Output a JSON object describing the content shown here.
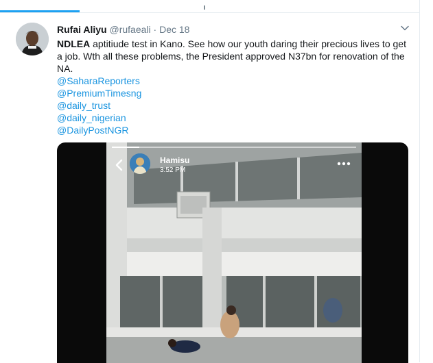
{
  "tweet": {
    "author_name": "Rufai Aliyu",
    "handle": "@rufaeali",
    "separator": "·",
    "date": "Dec 18",
    "text_bold": "NDLEA",
    "text_rest": " aptitiude test in Kano. See how our youth daring their precious lives to get a job. Wth all these problems, the President approved N37bn for renovation of the NA.",
    "mentions": [
      "@SaharaReporters",
      "@PremiumTimesng",
      "@daily_trust",
      "@daily_nigerian",
      "@DailyPostNGR"
    ]
  },
  "video": {
    "uploader": "Hamisu",
    "time": "3:52 PM"
  },
  "colors": {
    "accent": "#1da1f2",
    "link": "#1b95e0",
    "text": "#14171a",
    "muted": "#657786"
  },
  "icons": [
    "caret-down-icon",
    "back-arrow-icon",
    "more-options-icon"
  ]
}
